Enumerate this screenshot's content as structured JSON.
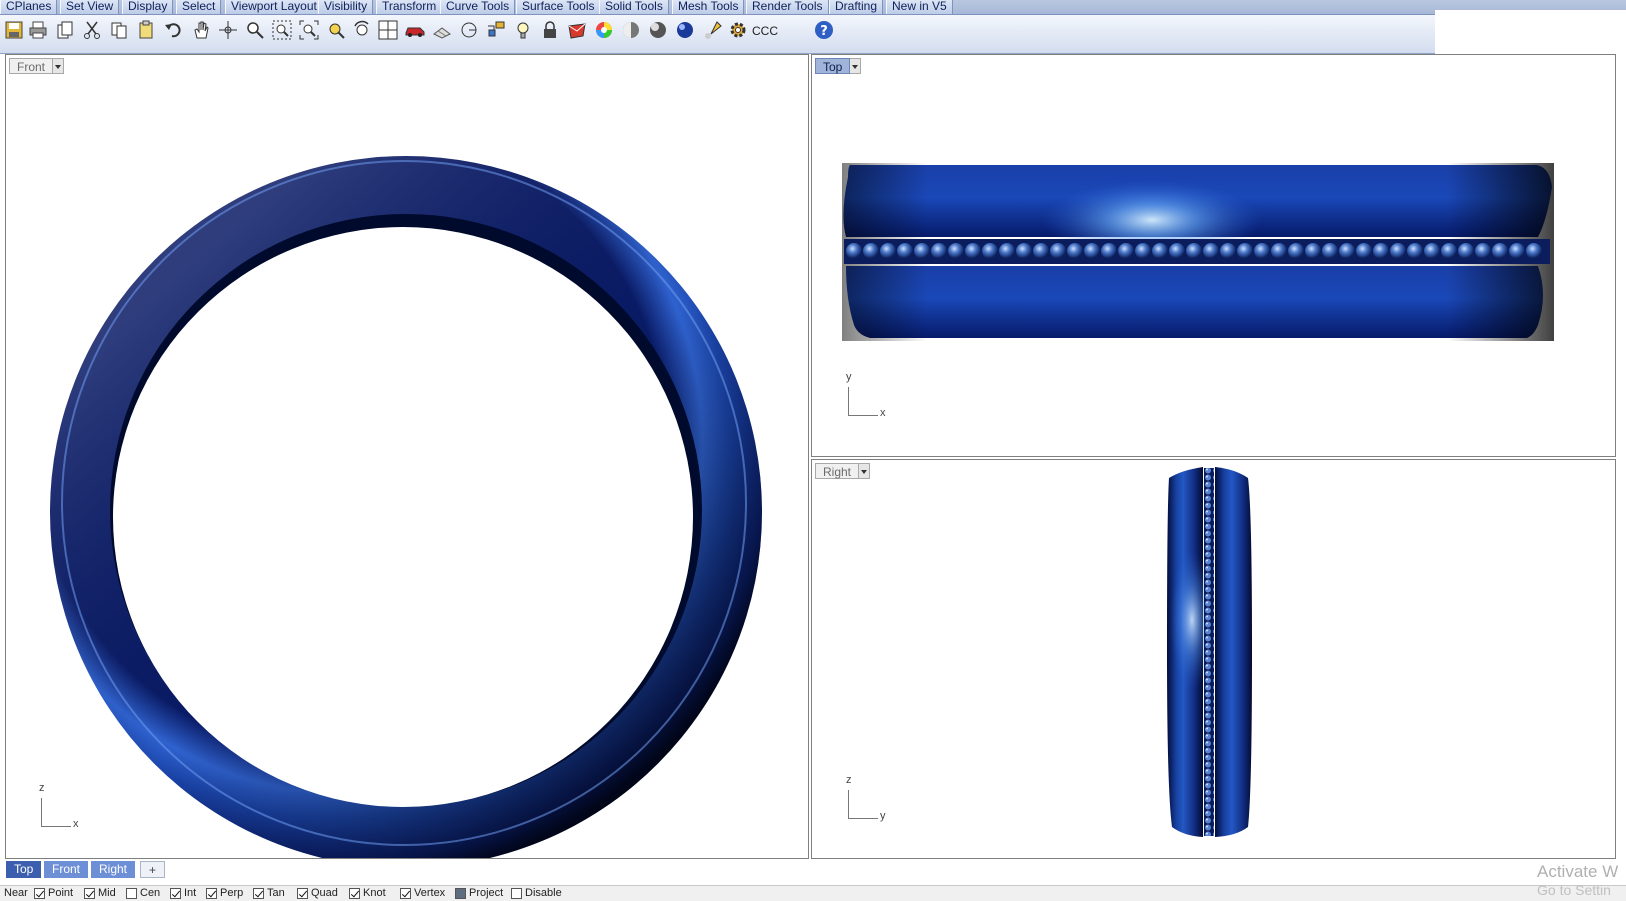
{
  "tabs": [
    "CPlanes",
    "Set View",
    "Display",
    "Select",
    "Viewport Layout",
    "Visibility",
    "Transform",
    "Curve Tools",
    "Surface Tools",
    "Solid Tools",
    "Mesh Tools",
    "Render Tools",
    "Drafting",
    "New in V5"
  ],
  "toolbar": {
    "icons": [
      "save-icon",
      "print-icon",
      "copy-doc-icon",
      "cut-icon",
      "copy-icon",
      "paste-icon",
      "undo-icon",
      "pan-hand-icon",
      "rotate-view-icon",
      "zoom-dynamic-icon",
      "zoom-window-icon",
      "zoom-extents-icon",
      "zoom-selected-icon",
      "undo-view-icon",
      "four-viewports-icon",
      "car-icon",
      "mesh-render-icon",
      "ellipse-icon",
      "grid-snap-icon",
      "light-icon",
      "lock-icon",
      "material-icon",
      "color-wheel-icon",
      "shade-icon",
      "ghosted-icon",
      "render-sphere-icon",
      "spotlight-icon",
      "settings-gear-icon"
    ],
    "text_button": "CCC",
    "help_icon": "help-icon"
  },
  "viewports": {
    "front": {
      "label": "Front",
      "axis_v": "z",
      "axis_h": "x"
    },
    "top": {
      "label": "Top",
      "axis_v": "y",
      "axis_h": "x"
    },
    "right": {
      "label": "Right",
      "axis_v": "z",
      "axis_h": "y"
    }
  },
  "bottom_tabs": [
    "Top",
    "Front",
    "Right"
  ],
  "osnap": [
    {
      "label": "Near",
      "checked": null
    },
    {
      "label": "Point",
      "checked": true
    },
    {
      "label": "Mid",
      "checked": true
    },
    {
      "label": "Cen",
      "checked": false
    },
    {
      "label": "Int",
      "checked": true
    },
    {
      "label": "Perp",
      "checked": true
    },
    {
      "label": "Tan",
      "checked": true
    },
    {
      "label": "Quad",
      "checked": true
    },
    {
      "label": "Knot",
      "checked": true
    },
    {
      "label": "Vertex",
      "checked": true
    },
    {
      "label": "Project",
      "checked": "filled"
    },
    {
      "label": "Disable",
      "checked": false
    }
  ],
  "watermark": {
    "line1": "Activate W",
    "line2": "Go to Settin"
  },
  "colors": {
    "ring_dark": "#02124e",
    "ring_mid": "#1f48b0",
    "ring_light": "#5b8ae6",
    "active_tab": "#3b5fae"
  }
}
